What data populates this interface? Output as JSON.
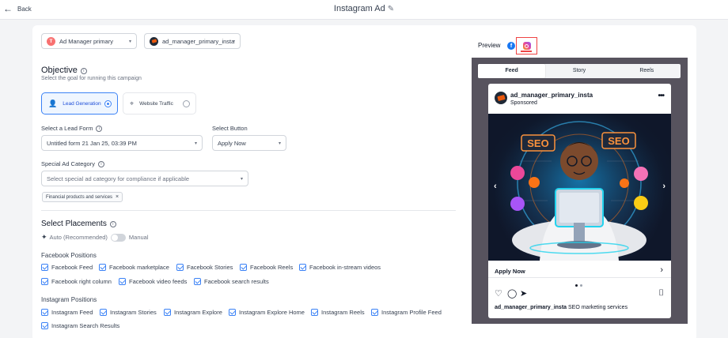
{
  "header": {
    "back_label": "Back",
    "title": "Instagram Ad"
  },
  "accounts": {
    "ad_account": "Ad Manager primary",
    "ad_account_initial": "T",
    "ig_account": "ad_manager_primary_insta"
  },
  "objective": {
    "title": "Objective",
    "subtitle": "Select the goal for running this campaign",
    "options": [
      {
        "label": "Lead Generation",
        "selected": true
      },
      {
        "label": "Website Traffic",
        "selected": false
      }
    ]
  },
  "lead_form": {
    "label": "Select a Lead Form",
    "value": "Untitled form 21 Jan 25, 03:39 PM"
  },
  "cta_button": {
    "label": "Select Button",
    "value": "Apply Now"
  },
  "special_ad": {
    "label": "Special Ad Category",
    "placeholder": "Select special ad category for compliance if applicable",
    "chips": [
      "Financial products and services"
    ]
  },
  "placements": {
    "title": "Select Placements",
    "auto_label": "Auto (Recommended)",
    "manual_label": "Manual",
    "facebook_title": "Facebook Positions",
    "facebook": [
      "Facebook Feed",
      "Facebook marketplace",
      "Facebook Stories",
      "Facebook Reels",
      "Facebook in-stream videos",
      "Facebook right column",
      "Facebook video feeds",
      "Facebook search results"
    ],
    "instagram_title": "Instagram Positions",
    "instagram": [
      "Instagram Feed",
      "Instagram Stories",
      "Instagram Explore",
      "Instagram Explore Home",
      "Instagram Reels",
      "Instagram Profile Feed",
      "Instagram Search Results"
    ]
  },
  "preview": {
    "label": "Preview",
    "tabs": [
      "Feed",
      "Story",
      "Reels"
    ],
    "active_tab": "Feed",
    "post": {
      "username": "ad_manager_primary_insta",
      "sponsored": "Sponsored",
      "image_text": [
        "SEO",
        "SEO"
      ],
      "cta": "Apply Now",
      "caption_user": "ad_manager_primary_insta",
      "caption_text": "SEO marketing services"
    }
  },
  "colors": {
    "accent": "#3b82f6",
    "highlight": "#ef4444",
    "preview_bg": "#57535e"
  }
}
